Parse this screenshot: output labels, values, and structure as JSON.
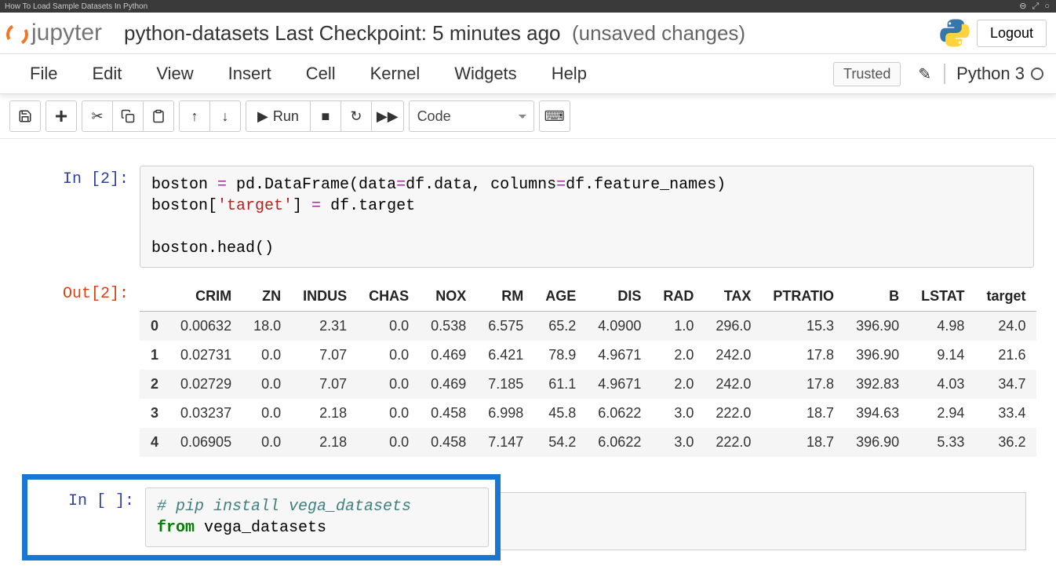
{
  "browser_tab": "How To Load Sample Datasets In Python",
  "header": {
    "logo": "jupyter",
    "doc_title": "python-datasets Last Checkpoint: 5 minutes ago",
    "unsaved": "(unsaved changes)",
    "logout": "Logout"
  },
  "menu": [
    "File",
    "Edit",
    "View",
    "Insert",
    "Cell",
    "Kernel",
    "Widgets",
    "Help"
  ],
  "trusted": "Trusted",
  "kernel": "Python 3",
  "toolbar": {
    "run": "Run",
    "celltype": "Code"
  },
  "cells": [
    {
      "prompt": "In [2]:",
      "code_plain": "boston = pd.DataFrame(data=df.data, columns=df.feature_names)\nboston['target'] = df.target\n\nboston.head()"
    },
    {
      "prompt": "Out[2]:"
    },
    {
      "prompt": "In [ ]:",
      "code_plain": "# pip install vega_datasets\nfrom vega_datasets"
    }
  ],
  "chart_data": {
    "type": "table",
    "columns": [
      "CRIM",
      "ZN",
      "INDUS",
      "CHAS",
      "NOX",
      "RM",
      "AGE",
      "DIS",
      "RAD",
      "TAX",
      "PTRATIO",
      "B",
      "LSTAT",
      "target"
    ],
    "index": [
      "0",
      "1",
      "2",
      "3",
      "4"
    ],
    "rows": [
      [
        "0.00632",
        "18.0",
        "2.31",
        "0.0",
        "0.538",
        "6.575",
        "65.2",
        "4.0900",
        "1.0",
        "296.0",
        "15.3",
        "396.90",
        "4.98",
        "24.0"
      ],
      [
        "0.02731",
        "0.0",
        "7.07",
        "0.0",
        "0.469",
        "6.421",
        "78.9",
        "4.9671",
        "2.0",
        "242.0",
        "17.8",
        "396.90",
        "9.14",
        "21.6"
      ],
      [
        "0.02729",
        "0.0",
        "7.07",
        "0.0",
        "0.469",
        "7.185",
        "61.1",
        "4.9671",
        "2.0",
        "242.0",
        "17.8",
        "392.83",
        "4.03",
        "34.7"
      ],
      [
        "0.03237",
        "0.0",
        "2.18",
        "0.0",
        "0.458",
        "6.998",
        "45.8",
        "6.0622",
        "3.0",
        "222.0",
        "18.7",
        "394.63",
        "2.94",
        "33.4"
      ],
      [
        "0.06905",
        "0.0",
        "2.18",
        "0.0",
        "0.458",
        "7.147",
        "54.2",
        "6.0622",
        "3.0",
        "222.0",
        "18.7",
        "396.90",
        "5.33",
        "36.2"
      ]
    ]
  }
}
